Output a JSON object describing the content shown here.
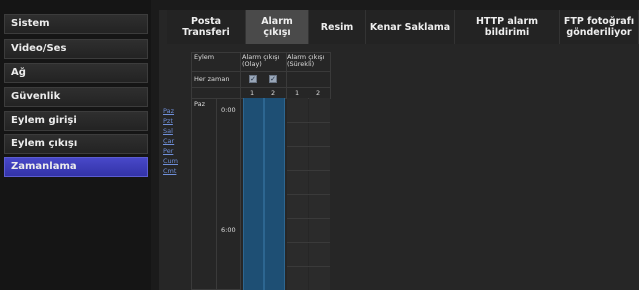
{
  "sidebar": {
    "items": [
      {
        "label": "Sistem"
      },
      {
        "label": "Video/Ses"
      },
      {
        "label": "Ağ"
      },
      {
        "label": "Güvenlik"
      },
      {
        "label": "Eylem girişi"
      },
      {
        "label": "Eylem çıkışı"
      },
      {
        "label": "Zamanlama"
      }
    ],
    "active_index": 6
  },
  "tabs": [
    {
      "label": "Posta Transferi"
    },
    {
      "label": "Alarm çıkışı"
    },
    {
      "label": "Resim"
    },
    {
      "label": "Kenar Saklama"
    },
    {
      "label": "HTTP alarm bildirimi"
    },
    {
      "label": "FTP fotoğrafı gönderiliyor"
    }
  ],
  "active_tab": 1,
  "days": [
    "Paz",
    "Pzt",
    "Sal",
    "Çar",
    "Per",
    "Cum",
    "Cmt"
  ],
  "schedule": {
    "eylem_label": "Eylem",
    "col_group1": "Alarm çıkışı (Olay)",
    "col_group2": "Alarm çıkışı (Sürekli)",
    "her_zaman_label": "Her zaman",
    "sub_cols": [
      "1",
      "2",
      "1",
      "2"
    ],
    "day_label": "Paz",
    "times": [
      "0:00",
      "6:00"
    ]
  },
  "colors": {
    "active_sidebar": "#3a3ab8",
    "schedule_blue": "#1e4f74",
    "link": "#6f8fd8"
  }
}
